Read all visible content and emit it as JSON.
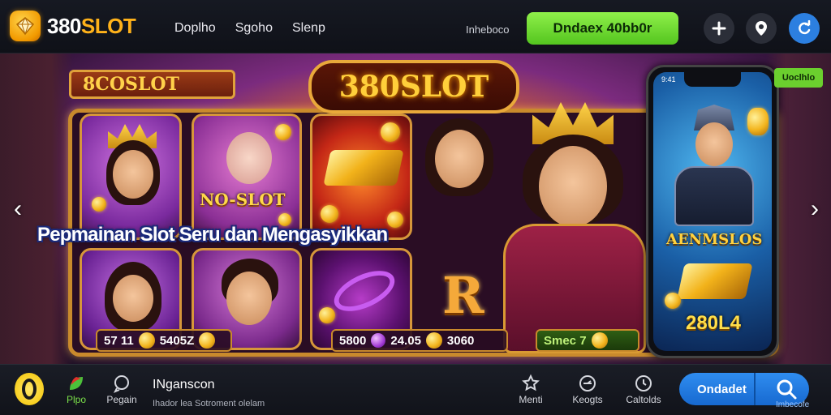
{
  "header": {
    "logo": {
      "num": "380",
      "word": "SLOT"
    },
    "nav": [
      "Doplho",
      "Sgoho",
      "Slenp"
    ],
    "tagline": "Inheboco",
    "cta_label": "Dndaex 40bb0r"
  },
  "hero": {
    "banner_left": "8COSLOT",
    "logo_banner": "380SLOT",
    "card_title": "NO-SLOT",
    "headline": "Pepmainan Slot Seru dan Mengasyikkan",
    "big_letter": "R",
    "stats": [
      {
        "label": "57 11",
        "value": "5405Z"
      },
      {
        "label": "5800",
        "value": "24.05",
        "extra": "3060"
      },
      {
        "label": "Smec 7"
      }
    ],
    "phone": {
      "status": "9:41",
      "title": "AENMSLOS",
      "number": "280L4"
    },
    "side_tag": "Uoclhlo",
    "prev_arrow": "‹",
    "next_arrow": "›"
  },
  "bottom": {
    "items": [
      {
        "icon": "leaf-icon",
        "label": "Plpo"
      },
      {
        "icon": "chat-icon",
        "label": "Pegain"
      }
    ],
    "title": "INganscon",
    "subtitle": "Ihador lea Sotroment olelam",
    "right_items": [
      {
        "icon": "star-icon",
        "label": "Menti"
      },
      {
        "icon": "gauge-icon",
        "label": "Keogts"
      },
      {
        "icon": "clock-icon",
        "label": "Caltolds"
      }
    ],
    "cta_label": "Ondadet",
    "cta_sub": "Imbecofe"
  },
  "colors": {
    "accent": "#ffb21a",
    "green": "#6bcf2e",
    "blue": "#2c7fe0"
  }
}
